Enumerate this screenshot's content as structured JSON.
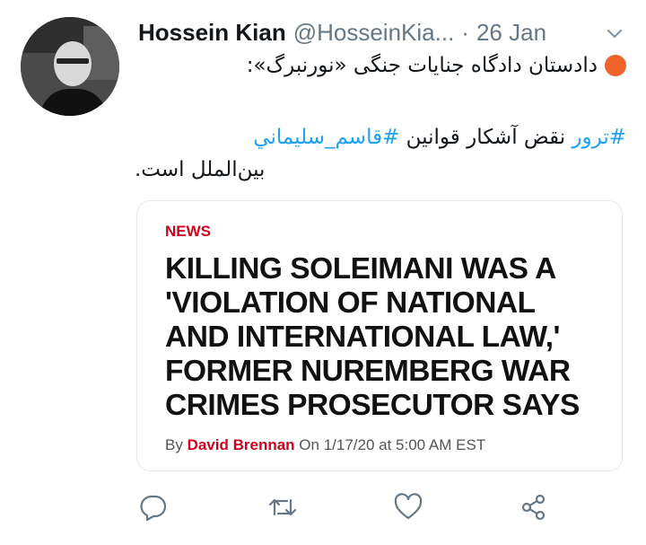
{
  "tweet": {
    "display_name": "Hossein Kian",
    "handle": "@HosseinKia...",
    "separator": "·",
    "date": "26 Jan",
    "text_line1": "دادستان دادگاه جنایات جنگی «نورنبرگ»:",
    "hashtag1": "#ترور",
    "hashtag2": "#قاسم_سليماني",
    "text_line2_mid": " نقض آشکار قوانین",
    "text_line3": "بین‌الملل است."
  },
  "card": {
    "label": "NEWS",
    "headline": [
      "KILLING SOLEIMANI WAS A",
      "'VIOLATION OF NATIONAL",
      "AND INTERNATIONAL LAW,'",
      "FORMER NUREMBERG WAR",
      "CRIMES PROSECUTOR SAYS"
    ],
    "by": "By",
    "author": "David Brennan",
    "date_text": "On 1/17/20 at 5:00 AM EST"
  },
  "colors": {
    "accent_blue": "#1da1f2",
    "news_red": "#d0021b",
    "dot_orange": "#f0642b",
    "icon_gray": "#657786"
  },
  "icons": [
    "reply-icon",
    "retweet-icon",
    "like-icon",
    "share-icon",
    "chevron-down-icon"
  ]
}
